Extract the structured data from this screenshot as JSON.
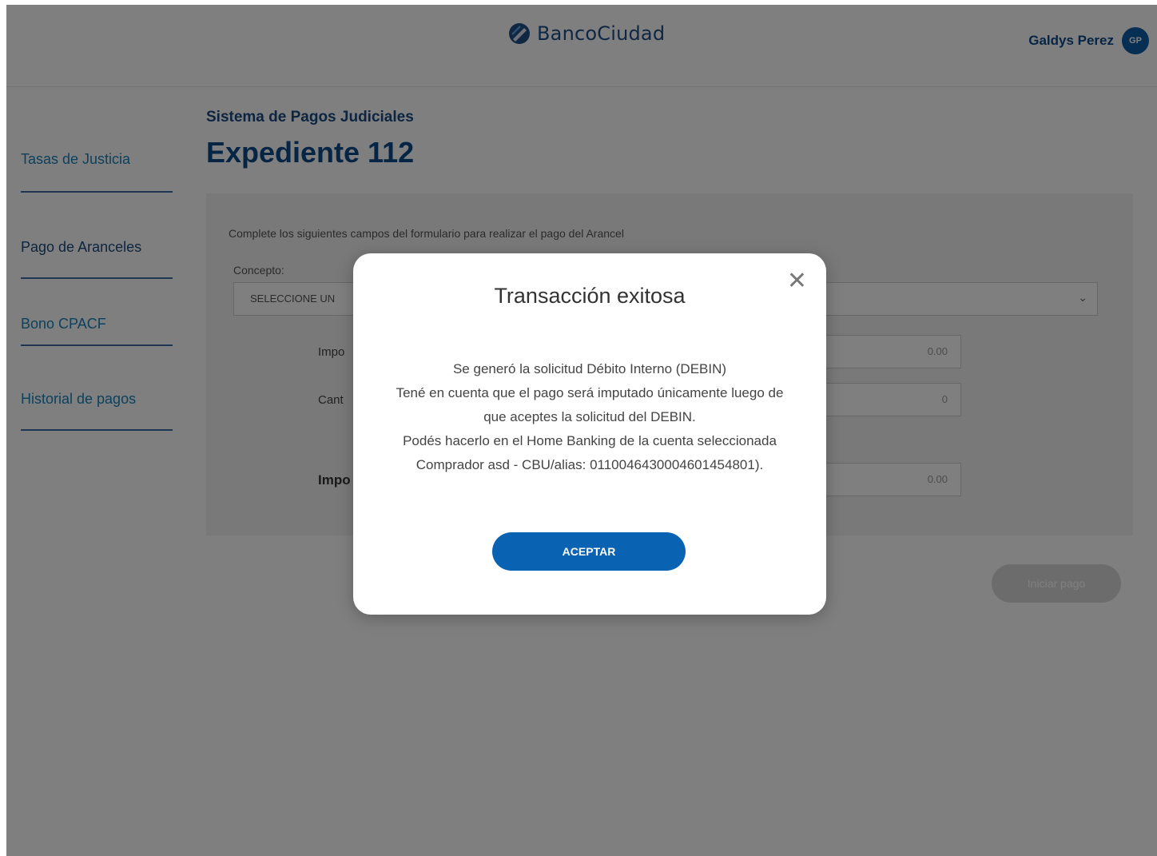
{
  "header": {
    "brand": "BancoCiudad",
    "user_name": "Galdys Perez",
    "avatar_initials": "GP"
  },
  "sidebar": {
    "items": [
      {
        "label": "Tasas de Justicia"
      },
      {
        "label": "Pago de Aranceles"
      },
      {
        "label": "Bono CPACF"
      },
      {
        "label": "Historial de pagos"
      }
    ]
  },
  "main": {
    "subtitle": "Sistema de Pagos Judiciales",
    "title": "Expediente 112",
    "form": {
      "intro": "Complete los siguientes campos del formulario para realizar el pago del Arancel",
      "concepto_label": "Concepto:",
      "concepto_value": "SELECCIONE UN",
      "rows": [
        {
          "label": "Impo",
          "value": "0.00"
        },
        {
          "label": "Cant",
          "value": "0"
        },
        {
          "label": "Impo",
          "value": "0.00"
        }
      ]
    },
    "start_button": "Iniciar pago"
  },
  "modal": {
    "title": "Transacción exitosa",
    "lines": [
      "Se generó la solicitud Débito Interno (DEBIN)",
      "Tené en cuenta que el pago será imputado únicamente luego de",
      "que aceptes la solicitud del DEBIN.",
      "Podés hacerlo en el Home Banking de la cuenta seleccionada",
      "Comprador asd - CBU/alias: 0110046430004601454801)."
    ],
    "accept_label": "ACEPTAR",
    "close_icon": "close-icon"
  },
  "colors": {
    "brand": "#0d4a8a",
    "accent_button": "#0a62b3",
    "sidebar_link": "#1a82b8"
  }
}
